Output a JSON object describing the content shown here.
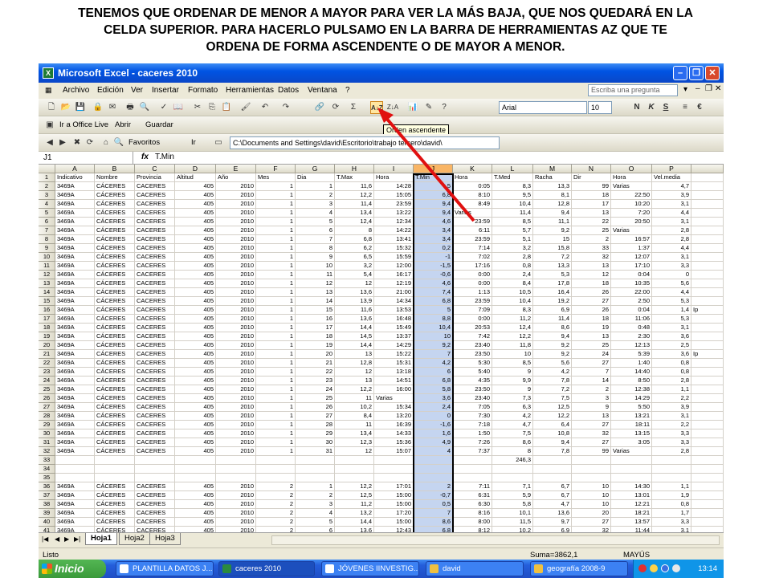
{
  "caption": {
    "line1": "TENEMOS QUE ORDENAR DE MENOR A MAYOR PARA VER LA MÁS BAJA, QUE NOS QUEDARÁ EN LA",
    "line2": "CELDA SUPERIOR. PARA HACERLO PULSAMO EN LA BARRA DE HERRAMIENTAS AZ QUE TE",
    "line3": "ORDENA DE FORMA ASCENDENTE O DE MAYOR A MENOR."
  },
  "window": {
    "title": "Microsoft Excel - caceres 2010"
  },
  "menu": {
    "items": [
      "Archivo",
      "Edición",
      "Ver",
      "Insertar",
      "Formato",
      "Herramientas",
      "Datos",
      "Ventana",
      "?"
    ],
    "ask_placeholder": "Escriba una pregunta"
  },
  "toolbar": {
    "font": "Arial",
    "size": "10",
    "tooltip": "Orden ascendente",
    "office_live": "Ir a Office Live",
    "abrir": "Abrir",
    "guardar": "Guardar",
    "favoritos": "Favoritos",
    "ir": "Ir",
    "path": "C:\\Documents and Settings\\david\\Escritorio\\trabajo tercero\\david\\"
  },
  "formula": {
    "namebox": "J1",
    "fx": "fx",
    "content": "T.Min"
  },
  "columns": [
    "A",
    "B",
    "C",
    "D",
    "E",
    "F",
    "G",
    "H",
    "I",
    "J",
    "K",
    "L",
    "M",
    "N",
    "O",
    "P"
  ],
  "rows": [
    {
      "n": "1",
      "v": [
        "Indicativo",
        "Nombre",
        "Provincia",
        "Altitud",
        "Año",
        "Mes",
        "Dia",
        "T.Max",
        "Hora",
        "T.Min",
        "Hora",
        "T.Med",
        "Racha",
        "Dir",
        "Hora",
        "Vel.media"
      ]
    },
    {
      "n": "2",
      "v": [
        "3469A",
        "CÁCERES",
        "CACERES",
        "405",
        "2010",
        "1",
        "1",
        "11,6",
        "14:28",
        "5",
        "0:05",
        "8,3",
        "13,3",
        "99",
        "Varias",
        "4,7"
      ]
    },
    {
      "n": "3",
      "v": [
        "3469A",
        "CÁCERES",
        "CACERES",
        "405",
        "2010",
        "1",
        "2",
        "12,2",
        "15:05",
        "6,8",
        "8:10",
        "9,5",
        "8,1",
        "18",
        "22:50",
        "3,9"
      ]
    },
    {
      "n": "4",
      "v": [
        "3469A",
        "CÁCERES",
        "CACERES",
        "405",
        "2010",
        "1",
        "3",
        "11,4",
        "23:59",
        "9,4",
        "8:49",
        "10,4",
        "12,8",
        "17",
        "10:20",
        "3,1"
      ]
    },
    {
      "n": "5",
      "v": [
        "3469A",
        "CÁCERES",
        "CACERES",
        "405",
        "2010",
        "1",
        "4",
        "13,4",
        "13:22",
        "9,4",
        "Varias",
        "11,4",
        "9,4",
        "13",
        "7:20",
        "4,4"
      ]
    },
    {
      "n": "6",
      "v": [
        "3469A",
        "CÁCERES",
        "CACERES",
        "405",
        "2010",
        "1",
        "5",
        "12,4",
        "12:34",
        "4,6",
        "23:59",
        "8,5",
        "11,1",
        "22",
        "20:50",
        "3,1"
      ]
    },
    {
      "n": "7",
      "v": [
        "3469A",
        "CÁCERES",
        "CACERES",
        "405",
        "2010",
        "1",
        "6",
        "8",
        "14:22",
        "3,4",
        "6:11",
        "5,7",
        "9,2",
        "25",
        "Varias",
        "2,8"
      ]
    },
    {
      "n": "8",
      "v": [
        "3469A",
        "CÁCERES",
        "CACERES",
        "405",
        "2010",
        "1",
        "7",
        "6,8",
        "13:41",
        "3,4",
        "23:59",
        "5,1",
        "15",
        "2",
        "16:57",
        "2,8"
      ]
    },
    {
      "n": "9",
      "v": [
        "3469A",
        "CÁCERES",
        "CACERES",
        "405",
        "2010",
        "1",
        "8",
        "6,2",
        "15:32",
        "0,2",
        "7:14",
        "3,2",
        "15,8",
        "33",
        "1:37",
        "4,4"
      ]
    },
    {
      "n": "10",
      "v": [
        "3469A",
        "CÁCERES",
        "CACERES",
        "405",
        "2010",
        "1",
        "9",
        "6,5",
        "15:59",
        "-1",
        "7:02",
        "2,8",
        "7,2",
        "32",
        "12:07",
        "3,1"
      ]
    },
    {
      "n": "11",
      "v": [
        "3469A",
        "CÁCERES",
        "CACERES",
        "405",
        "2010",
        "1",
        "10",
        "3,2",
        "12:00",
        "-1,5",
        "17:16",
        "0,8",
        "13,3",
        "13",
        "17:10",
        "3,3"
      ]
    },
    {
      "n": "12",
      "v": [
        "3469A",
        "CÁCERES",
        "CACERES",
        "405",
        "2010",
        "1",
        "11",
        "5,4",
        "16:17",
        "-0,6",
        "0:00",
        "2,4",
        "5,3",
        "12",
        "0:04",
        "0"
      ]
    },
    {
      "n": "13",
      "v": [
        "3469A",
        "CÁCERES",
        "CACERES",
        "405",
        "2010",
        "1",
        "12",
        "12",
        "12:19",
        "4,6",
        "0:00",
        "8,4",
        "17,8",
        "18",
        "10:35",
        "5,6"
      ]
    },
    {
      "n": "14",
      "v": [
        "3469A",
        "CÁCERES",
        "CACERES",
        "405",
        "2010",
        "1",
        "13",
        "13,6",
        "21:00",
        "7,4",
        "1:13",
        "10,5",
        "16,4",
        "26",
        "22:00",
        "4,4"
      ]
    },
    {
      "n": "15",
      "v": [
        "3469A",
        "CÁCERES",
        "CACERES",
        "405",
        "2010",
        "1",
        "14",
        "13,9",
        "14:34",
        "6,8",
        "23:59",
        "10,4",
        "19,2",
        "27",
        "2:50",
        "5,3"
      ]
    },
    {
      "n": "16",
      "v": [
        "3469A",
        "CÁCERES",
        "CACERES",
        "405",
        "2010",
        "1",
        "15",
        "11,6",
        "13:53",
        "5",
        "7:09",
        "8,3",
        "6,9",
        "26",
        "0:04",
        "1,4",
        "Ip"
      ]
    },
    {
      "n": "17",
      "v": [
        "3469A",
        "CÁCERES",
        "CACERES",
        "405",
        "2010",
        "1",
        "16",
        "13,6",
        "16:48",
        "8,8",
        "0:00",
        "11,2",
        "11,4",
        "18",
        "11:06",
        "5,3"
      ]
    },
    {
      "n": "18",
      "v": [
        "3469A",
        "CÁCERES",
        "CACERES",
        "405",
        "2010",
        "1",
        "17",
        "14,4",
        "15:49",
        "10,4",
        "20:53",
        "12,4",
        "8,6",
        "19",
        "0:48",
        "3,1"
      ]
    },
    {
      "n": "19",
      "v": [
        "3469A",
        "CÁCERES",
        "CACERES",
        "405",
        "2010",
        "1",
        "18",
        "14,5",
        "13:37",
        "10",
        "7:42",
        "12,2",
        "9,4",
        "13",
        "2:30",
        "3,6"
      ]
    },
    {
      "n": "20",
      "v": [
        "3469A",
        "CÁCERES",
        "CACERES",
        "405",
        "2010",
        "1",
        "19",
        "14,4",
        "14:29",
        "9,2",
        "23:40",
        "11,8",
        "9,2",
        "25",
        "12:13",
        "2,5"
      ]
    },
    {
      "n": "21",
      "v": [
        "3469A",
        "CÁCERES",
        "CACERES",
        "405",
        "2010",
        "1",
        "20",
        "13",
        "15:22",
        "7",
        "23:50",
        "10",
        "9,2",
        "24",
        "5:39",
        "3,6",
        "Ip"
      ]
    },
    {
      "n": "22",
      "v": [
        "3469A",
        "CÁCERES",
        "CACERES",
        "405",
        "2010",
        "1",
        "21",
        "12,8",
        "15:31",
        "4,2",
        "5:30",
        "8,5",
        "5,6",
        "27",
        "1:40",
        "0,8"
      ]
    },
    {
      "n": "23",
      "v": [
        "3469A",
        "CÁCERES",
        "CACERES",
        "405",
        "2010",
        "1",
        "22",
        "12",
        "13:18",
        "6",
        "5:40",
        "9",
        "4,2",
        "7",
        "14:40",
        "0,8"
      ]
    },
    {
      "n": "24",
      "v": [
        "3469A",
        "CÁCERES",
        "CACERES",
        "405",
        "2010",
        "1",
        "23",
        "13",
        "14:51",
        "6,8",
        "4:35",
        "9,9",
        "7,8",
        "14",
        "8:50",
        "2,8"
      ]
    },
    {
      "n": "25",
      "v": [
        "3469A",
        "CÁCERES",
        "CACERES",
        "405",
        "2010",
        "1",
        "24",
        "12,2",
        "16:00",
        "5,8",
        "23:50",
        "9",
        "7,2",
        "2",
        "12:38",
        "1,1"
      ]
    },
    {
      "n": "26",
      "v": [
        "3469A",
        "CÁCERES",
        "CACERES",
        "405",
        "2010",
        "1",
        "25",
        "11",
        "Varias",
        "3,6",
        "23:40",
        "7,3",
        "7,5",
        "3",
        "14:29",
        "2,2"
      ]
    },
    {
      "n": "27",
      "v": [
        "3469A",
        "CÁCERES",
        "CACERES",
        "405",
        "2010",
        "1",
        "26",
        "10,2",
        "15:34",
        "2,4",
        "7:05",
        "6,3",
        "12,5",
        "9",
        "5:50",
        "3,9"
      ]
    },
    {
      "n": "28",
      "v": [
        "3469A",
        "CÁCERES",
        "CACERES",
        "405",
        "2010",
        "1",
        "27",
        "8,4",
        "13:20",
        "0",
        "7:30",
        "4,2",
        "12,2",
        "13",
        "13:21",
        "3,1"
      ]
    },
    {
      "n": "29",
      "v": [
        "3469A",
        "CÁCERES",
        "CACERES",
        "405",
        "2010",
        "1",
        "28",
        "11",
        "16:39",
        "-1,6",
        "7:18",
        "4,7",
        "6,4",
        "27",
        "18:11",
        "2,2"
      ]
    },
    {
      "n": "30",
      "v": [
        "3469A",
        "CÁCERES",
        "CACERES",
        "405",
        "2010",
        "1",
        "29",
        "13,4",
        "14:33",
        "1,6",
        "1:50",
        "7,5",
        "10,8",
        "32",
        "13:15",
        "3,3"
      ]
    },
    {
      "n": "31",
      "v": [
        "3469A",
        "CÁCERES",
        "CACERES",
        "405",
        "2010",
        "1",
        "30",
        "12,3",
        "15:36",
        "4,9",
        "7:26",
        "8,6",
        "9,4",
        "27",
        "3:05",
        "3,3"
      ]
    },
    {
      "n": "32",
      "v": [
        "3469A",
        "CÁCERES",
        "CACERES",
        "405",
        "2010",
        "1",
        "31",
        "12",
        "15:07",
        "4",
        "7:37",
        "8",
        "7,8",
        "99",
        "Varias",
        "2,8"
      ]
    },
    {
      "n": "33",
      "v": [
        "",
        "",
        "",
        "",
        "",
        "",
        "",
        "",
        "",
        "",
        "",
        "246,3",
        "",
        "",
        "",
        ""
      ]
    },
    {
      "n": "34",
      "v": []
    },
    {
      "n": "35",
      "v": []
    },
    {
      "n": "36",
      "v": [
        "3469A",
        "CÁCERES",
        "CACERES",
        "405",
        "2010",
        "2",
        "1",
        "12,2",
        "17:01",
        "2",
        "7:11",
        "7,1",
        "6,7",
        "10",
        "14:30",
        "1,1"
      ]
    },
    {
      "n": "37",
      "v": [
        "3469A",
        "CÁCERES",
        "CACERES",
        "405",
        "2010",
        "2",
        "2",
        "12,5",
        "15:00",
        "-0,7",
        "6:31",
        "5,9",
        "6,7",
        "10",
        "13:01",
        "1,9"
      ]
    },
    {
      "n": "38",
      "v": [
        "3469A",
        "CÁCERES",
        "CACERES",
        "405",
        "2010",
        "2",
        "3",
        "11,2",
        "15:00",
        "0,5",
        "6:30",
        "5,8",
        "4,7",
        "10",
        "12:21",
        "0,8"
      ]
    },
    {
      "n": "39",
      "v": [
        "3469A",
        "CÁCERES",
        "CACERES",
        "405",
        "2010",
        "2",
        "4",
        "13,2",
        "17:20",
        "7",
        "8:16",
        "10,1",
        "13,6",
        "20",
        "18:21",
        "1,7"
      ]
    },
    {
      "n": "40",
      "v": [
        "3469A",
        "CÁCERES",
        "CACERES",
        "405",
        "2010",
        "2",
        "5",
        "14,4",
        "15:00",
        "8,6",
        "8:00",
        "11,5",
        "9,7",
        "27",
        "13:57",
        "3,3"
      ]
    },
    {
      "n": "41",
      "v": [
        "3469A",
        "CÁCERES",
        "CACERES",
        "405",
        "2010",
        "2",
        "6",
        "13,6",
        "12:43",
        "6,8",
        "8:12",
        "10,2",
        "6,9",
        "32",
        "11:44",
        "3,1"
      ]
    },
    {
      "n": "42",
      "v": [
        "3469A",
        "CÁCERES",
        "CACERES",
        "405",
        "2010",
        "2",
        "7",
        "13,4",
        "15:55",
        "4,9",
        "6:30",
        "9,2",
        "7,2",
        "18",
        "18:50",
        "0,6"
      ]
    }
  ],
  "sheets": [
    "Hoja1",
    "Hoja2",
    "Hoja3"
  ],
  "status": {
    "left": "Listo",
    "sum": "Suma=3862,1",
    "caps": "MAYÚS"
  },
  "taskbar": {
    "start": "Inicio",
    "tasks": [
      "PLANTILLA DATOS J...",
      "caceres 2010",
      "JÓVENES IINVESTIG...",
      "david",
      "geografía 2008-9"
    ],
    "clock": "13:14"
  }
}
